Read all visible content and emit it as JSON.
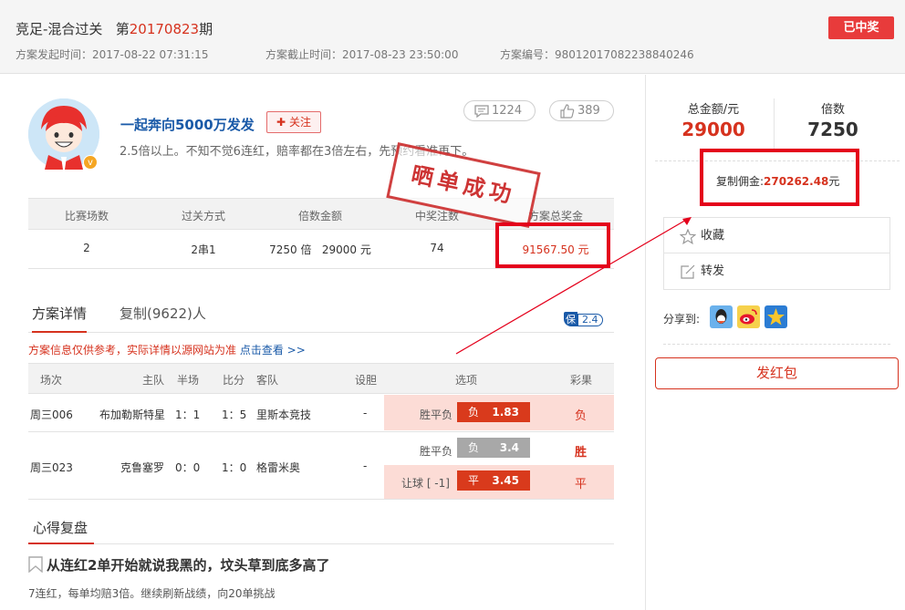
{
  "header": {
    "title_prefix": "竞足-混合过关",
    "title_mid": "第",
    "issue": "20170823",
    "title_suffix": "期",
    "start_time": "方案发起时间：2017-08-22 07:31:15",
    "end_time": "方案截止时间：2017-08-23 23:50:00",
    "plan_no": "方案编号：98012017082238840246",
    "status_button": "已中奖"
  },
  "user": {
    "name": "一起奔向5000万发发",
    "follow_label": "关注",
    "description": "2.5倍以上。不知不觉6连红，赔率都在3倍左右，先预约看准再下。",
    "comments": "1224",
    "likes": "389"
  },
  "stamp_text": "晒单成功",
  "stats": {
    "headers": [
      "比赛场数",
      "过关方式",
      "倍数金额",
      "中奖注数",
      "方案总奖金"
    ],
    "values": [
      "2",
      "2串1",
      "7250 倍   29000 元",
      "74",
      "91567.50 元"
    ]
  },
  "tabs": {
    "detail": "方案详情",
    "copy": "复制(9622)人",
    "bao_icon": "保",
    "bao_value": "2.4"
  },
  "notice": {
    "text": "方案信息仅供参考，实际详情以源网站为准",
    "link": "点击查看 >>"
  },
  "match_table": {
    "headers": [
      "场次",
      "主队",
      "半场",
      "比分",
      "客队",
      "设胆",
      "选项",
      "彩果"
    ],
    "rows": [
      {
        "id": "周三006",
        "home": "布加勒斯特星",
        "half": "1：1",
        "score": "1：5",
        "away": "里斯本竞技",
        "banker": "-",
        "options": [
          {
            "play": "胜平负",
            "pick": "负",
            "odds": "1.83",
            "result": "负"
          }
        ]
      },
      {
        "id": "周三023",
        "home": "克鲁塞罗",
        "half": "0：0",
        "score": "1：0",
        "away": "格雷米奥",
        "banker": "-",
        "options": [
          {
            "play": "胜平负",
            "pick": "负",
            "odds": "3.4",
            "result": "胜"
          },
          {
            "play": "让球 [ -1]",
            "pick": "平",
            "odds": "3.45",
            "result": "平"
          }
        ]
      }
    ]
  },
  "review": {
    "section_title": "心得复盘",
    "post_title": "从连红2单开始就说我黑的，坟头草到底多高了",
    "post_desc": "7连红，每单均赔3倍。继续刷新战绩，向20单挑战"
  },
  "sidebar": {
    "total_label": "总金额/元",
    "total_value": "29000",
    "multiple_label": "倍数",
    "multiple_value": "7250",
    "commission_label": "复制佣金:",
    "commission_value": "270262.48",
    "commission_unit": "元",
    "favorite": "收藏",
    "forward": "转发",
    "share_label": "分享到:",
    "hongbao": "发红包"
  },
  "colors": {
    "accent_red": "#d6321e",
    "highlight_box": "#e4001b",
    "link_blue": "#1a5aa8",
    "option_bg": "#fcdcd6"
  },
  "icons": [
    "comment-icon",
    "thumbs-up-icon",
    "star-icon",
    "share-edit-icon",
    "qq-icon",
    "weibo-icon",
    "qzone-icon",
    "bookmark-icon",
    "verified-badge-icon"
  ]
}
